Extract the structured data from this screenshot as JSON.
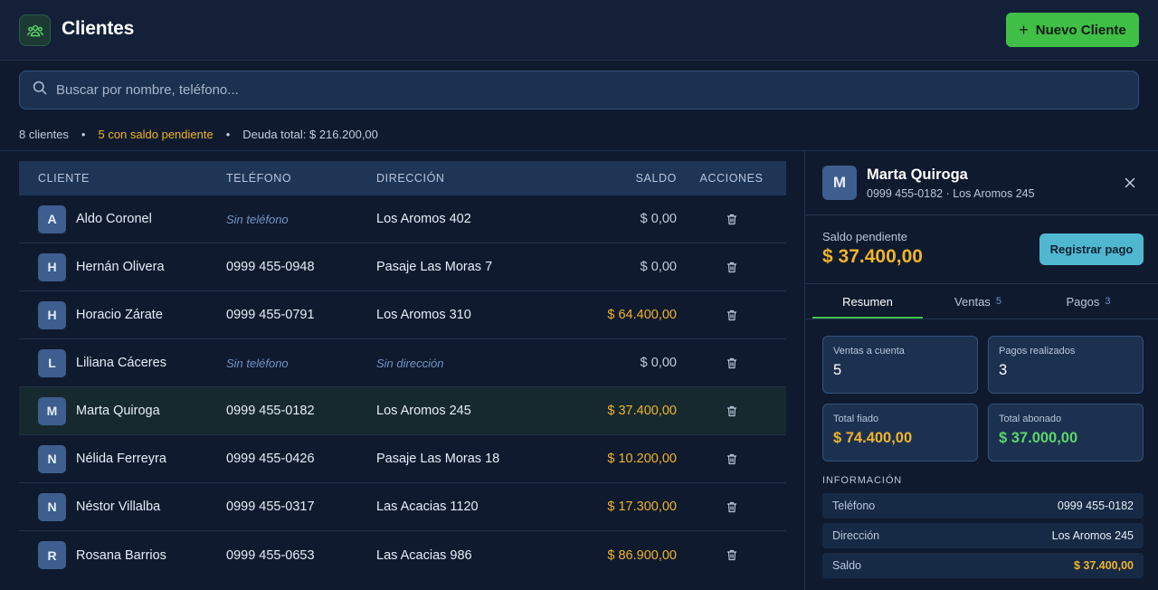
{
  "header": {
    "icon": "users-icon",
    "title": "Clientes",
    "new_button": "Nuevo Cliente"
  },
  "search": {
    "placeholder": "Buscar por nombre, teléfono...",
    "value": ""
  },
  "stats": {
    "count": "8 clientes",
    "pending": "5 con saldo pendiente",
    "debt": "Deuda total: $ 216.200,00"
  },
  "table": {
    "headers": [
      "CLIENTE",
      "TELÉFONO",
      "DIRECCIÓN",
      "SALDO",
      "ACCIONES"
    ],
    "rows": [
      {
        "initial": "A",
        "name": "Aldo Coronel",
        "phone": "Sin teléfono",
        "address": "Los Aromos 402",
        "balance": "$ 0,00"
      },
      {
        "initial": "H",
        "name": "Hernán Olivera",
        "phone": "0999 455-0948",
        "address": "Pasaje Las Moras 7",
        "balance": "$ 0,00"
      },
      {
        "initial": "H",
        "name": "Horacio Zárate",
        "phone": "0999 455-0791",
        "address": "Los Aromos 310",
        "balance": "$ 64.400,00"
      },
      {
        "initial": "L",
        "name": "Liliana Cáceres",
        "phone": "Sin teléfono",
        "address": "Sin dirección",
        "balance": "$ 0,00"
      },
      {
        "initial": "M",
        "name": "Marta Quiroga",
        "phone": "0999 455-0182",
        "address": "Los Aromos 245",
        "balance": "$ 37.400,00"
      },
      {
        "initial": "N",
        "name": "Nélida Ferreyra",
        "phone": "0999 455-0426",
        "address": "Pasaje Las Moras 18",
        "balance": "$ 10.200,00"
      },
      {
        "initial": "N",
        "name": "Néstor Villalba",
        "phone": "0999 455-0317",
        "address": "Las Acacias 1120",
        "balance": "$ 17.300,00"
      },
      {
        "initial": "R",
        "name": "Rosana Barrios",
        "phone": "0999 455-0653",
        "address": "Las Acacias 986",
        "balance": "$ 86.900,00"
      }
    ]
  },
  "detail": {
    "initial": "M",
    "name": "Marta Quiroga",
    "subtitle": "0999 455-0182 · Los Aromos 245",
    "balance_label": "Saldo pendiente",
    "balance": "$ 37.400,00",
    "register_button": "Registrar pago",
    "tabs": [
      {
        "label": "Resumen",
        "count": ""
      },
      {
        "label": "Ventas",
        "count": "5"
      },
      {
        "label": "Pagos",
        "count": "3"
      }
    ],
    "cards": {
      "sales_label": "Ventas a cuenta",
      "sales_value": "5",
      "payments_label": "Pagos realizados",
      "payments_value": "3",
      "credit_label": "Total fiado",
      "credit_value": "$ 74.400,00",
      "paid_label": "Total abonado",
      "paid_value": "$ 37.000,00"
    },
    "info_title": "INFORMACIÓN",
    "info": {
      "phone_label": "Teléfono",
      "phone_value": "0999 455-0182",
      "address_label": "Dirección",
      "address_value": "Los Aromos 245",
      "balance_label": "Saldo",
      "balance_value": "$ 37.400,00"
    }
  },
  "colors": {
    "background": "#0f1a2e",
    "accent_green": "#3fbf46",
    "debt_yellow": "#f0b429",
    "register_cyan": "#4fb8d0"
  }
}
